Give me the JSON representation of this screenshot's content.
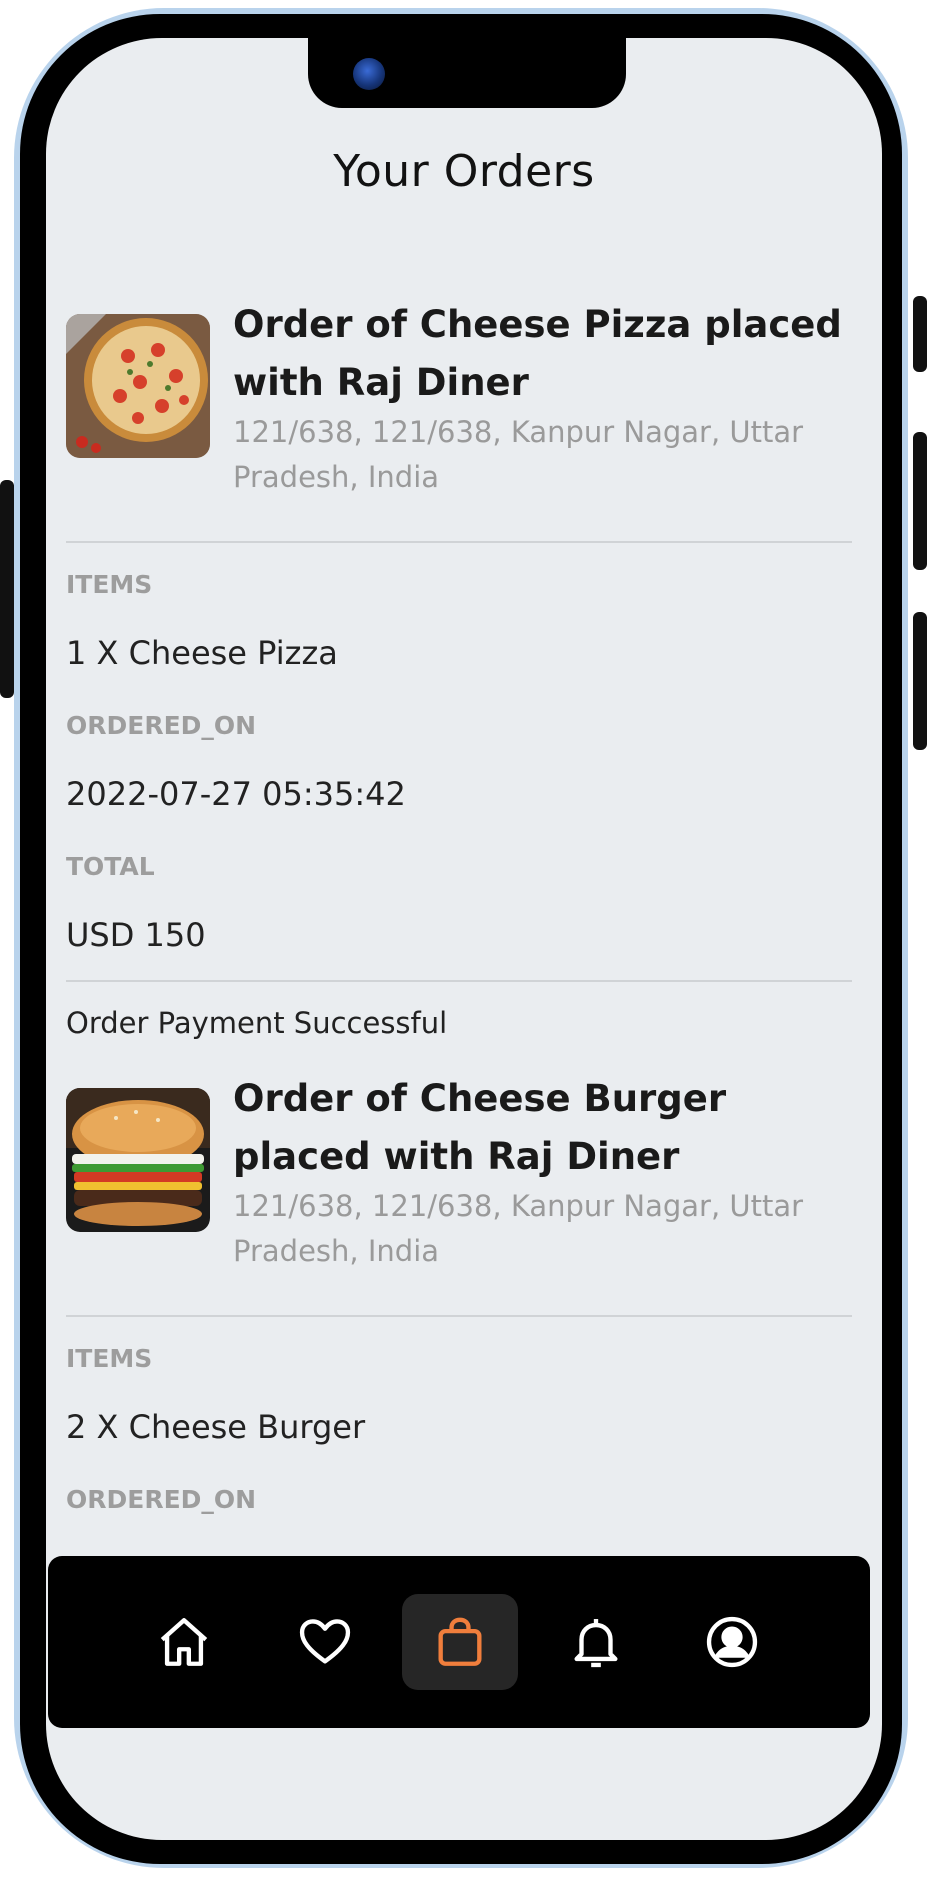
{
  "page": {
    "title": "Your Orders"
  },
  "orders": [
    {
      "title": "Order of Cheese Pizza placed with Raj Diner",
      "address": "121/638, 121/638, Kanpur Nagar, Uttar Pradesh, India",
      "items_label": "ITEMS",
      "items": "1 X Cheese Pizza",
      "ordered_on_label": "ORDERED_ON",
      "ordered_on": "2022-07-27 05:35:42",
      "total_label": "TOTAL",
      "total": "USD 150",
      "status": "Order Payment Successful",
      "image_icon": "pizza-image"
    },
    {
      "title": "Order of Cheese Burger placed with Raj Diner",
      "address": "121/638, 121/638, Kanpur Nagar, Uttar Pradesh, India",
      "items_label": "ITEMS",
      "items": "2 X Cheese Burger",
      "ordered_on_label": "ORDERED_ON",
      "image_icon": "burger-image"
    }
  ],
  "nav": {
    "items": [
      {
        "icon": "home-icon",
        "active": false
      },
      {
        "icon": "heart-icon",
        "active": false
      },
      {
        "icon": "shopping-bag-icon",
        "active": true
      },
      {
        "icon": "bell-icon",
        "active": false
      },
      {
        "icon": "user-circle-icon",
        "active": false
      }
    ],
    "active_color": "#f07e3c",
    "icon_color": "#ffffff"
  }
}
